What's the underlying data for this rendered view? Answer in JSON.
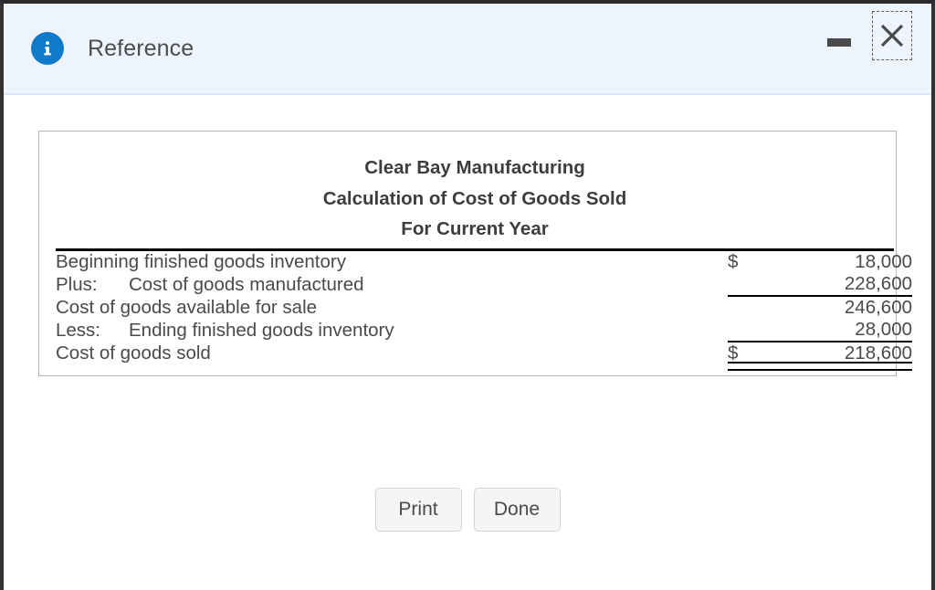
{
  "window": {
    "title": "Reference",
    "info_icon": "info-icon",
    "minimize_label": "Minimize",
    "close_label": "Close",
    "accent_color": "#0f7ac8",
    "titlebar_bg": "#eef4fd"
  },
  "statement": {
    "title_line_1": "Clear Bay Manufacturing",
    "title_line_2": "Calculation of Cost of Goods Sold",
    "title_line_3": "For Current Year",
    "rows": [
      {
        "label": "Beginning finished goods inventory",
        "prefix": "",
        "currency": "$",
        "value": "18,000",
        "rule": "none"
      },
      {
        "label": "Cost of goods manufactured",
        "prefix": "Plus:",
        "currency": "",
        "value": "228,600",
        "rule": "single"
      },
      {
        "label": "Cost of goods available for sale",
        "prefix": "",
        "currency": "",
        "value": "246,600",
        "rule": "none"
      },
      {
        "label": "Ending finished goods inventory",
        "prefix": "Less:",
        "currency": "",
        "value": "28,000",
        "rule": "single"
      },
      {
        "label": "Cost of goods sold",
        "prefix": "",
        "currency": "$",
        "value": "218,600",
        "rule": "double"
      }
    ]
  },
  "footer": {
    "print_label": "Print",
    "done_label": "Done"
  }
}
